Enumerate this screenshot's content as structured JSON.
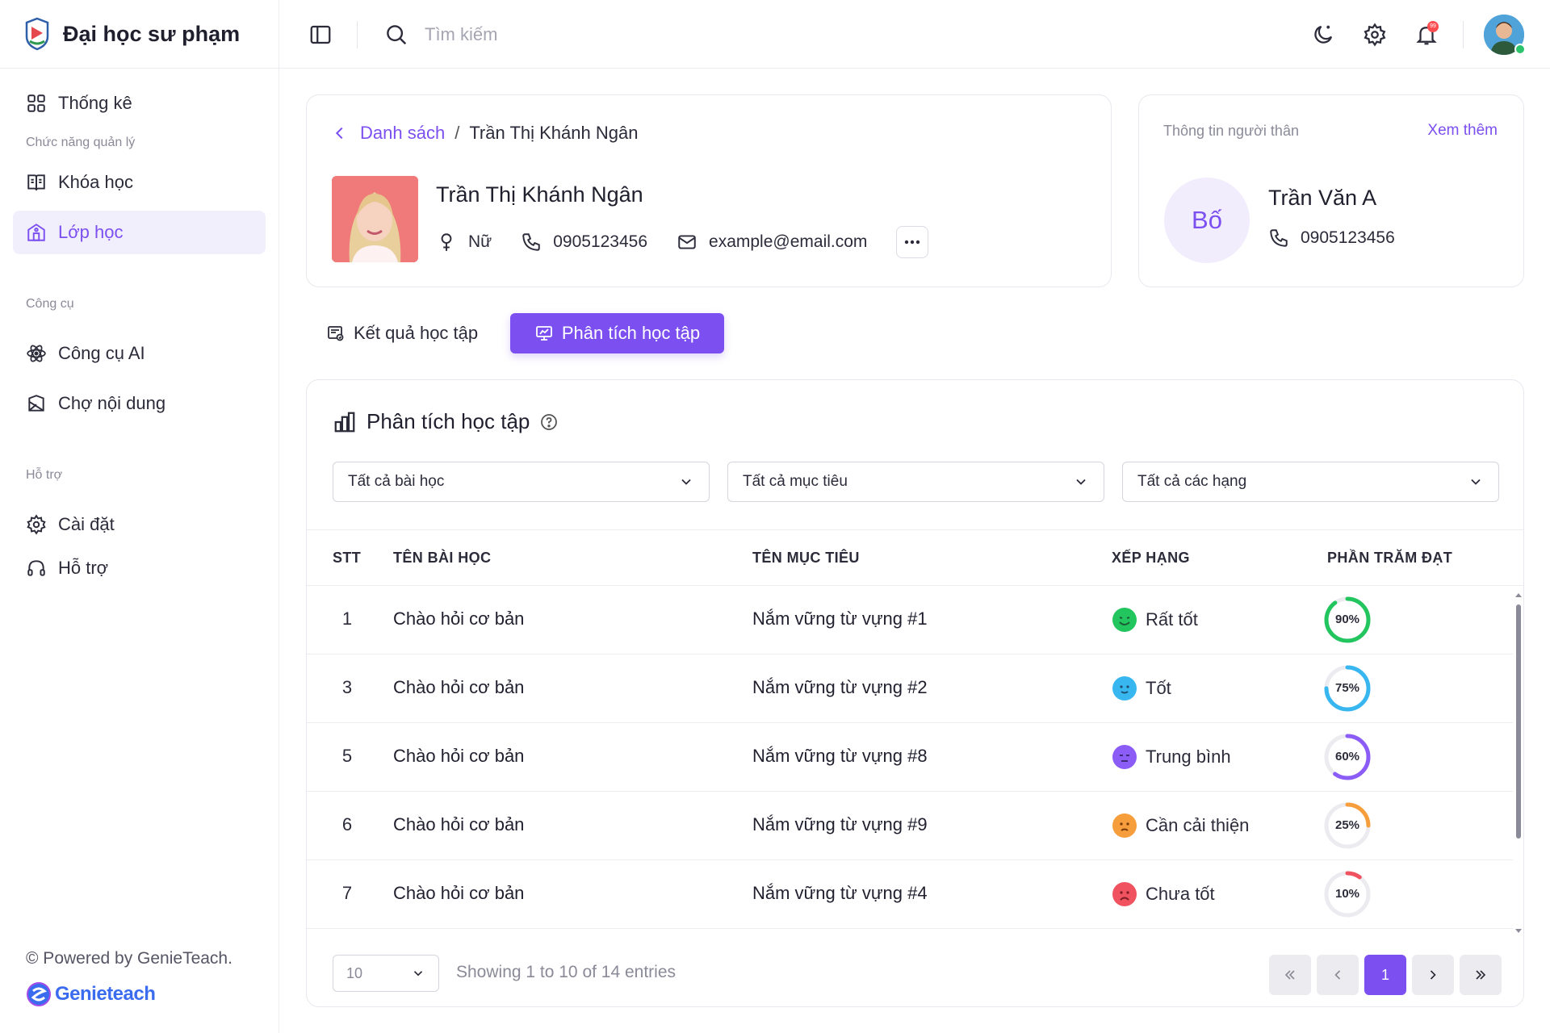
{
  "brand": {
    "name": "Đại học sư phạm"
  },
  "sidebar": {
    "items": [
      {
        "label": "Thống kê",
        "icon": "grid-icon"
      },
      {
        "label": "Khóa học",
        "icon": "book-icon"
      },
      {
        "label": "Lớp học",
        "icon": "school-icon",
        "active": true
      },
      {
        "label": "Công cụ AI",
        "icon": "atom-icon"
      },
      {
        "label": "Chợ nội dung",
        "icon": "market-icon"
      },
      {
        "label": "Cài đặt",
        "icon": "gear-icon"
      },
      {
        "label": "Hỗ trợ",
        "icon": "headset-icon"
      }
    ],
    "sections": [
      "Chức năng quản lý",
      "Công cụ",
      "Hỗ trợ"
    ],
    "powered_by": "© Powered by GenieTeach.",
    "genie_logo_text": "Genieteach"
  },
  "header": {
    "search_placeholder": "Tìm kiếm",
    "notification_count": "99"
  },
  "profile": {
    "breadcrumb_link": "Danh sách",
    "breadcrumb_sep": "/",
    "breadcrumb_current": "Trần Thị Khánh Ngân",
    "name": "Trần Thị Khánh Ngân",
    "gender": "Nữ",
    "phone": "0905123456",
    "email": "example@email.com"
  },
  "relative": {
    "title": "Thông tin người thân",
    "more": "Xem thêm",
    "relation": "Bố",
    "name": "Trần Văn A",
    "phone": "0905123456"
  },
  "tabs": {
    "results": "Kết quả học tập",
    "analysis": "Phân tích học tập"
  },
  "analysis": {
    "title": "Phân tích học tập",
    "filters": [
      "Tất cả bài học",
      "Tất cả mục tiêu",
      "Tất cả các hạng"
    ],
    "columns": [
      "STT",
      "TÊN BÀI HỌC",
      "TÊN MỤC TIÊU",
      "XẾP HẠNG",
      "PHẦN TRĂM ĐẠT"
    ],
    "rows": [
      {
        "stt": "1",
        "lesson": "Chào hỏi cơ bản",
        "goal": "Nắm vững từ vựng #1",
        "rank": "Rất tốt",
        "percent": 90,
        "percent_label": "90%",
        "color": "#22c55e"
      },
      {
        "stt": "3",
        "lesson": "Chào hỏi cơ bản",
        "goal": "Nắm vững từ vựng #2",
        "rank": "Tốt",
        "percent": 75,
        "percent_label": "75%",
        "color": "#38b6f0"
      },
      {
        "stt": "5",
        "lesson": "Chào hỏi cơ bản",
        "goal": "Nắm vững từ vựng #8",
        "rank": "Trung bình",
        "percent": 60,
        "percent_label": "60%",
        "color": "#8b5cf6"
      },
      {
        "stt": "6",
        "lesson": "Chào hỏi cơ bản",
        "goal": "Nắm vững từ vựng #9",
        "rank": "Cần cải thiện",
        "percent": 25,
        "percent_label": "25%",
        "color": "#f59e3b"
      },
      {
        "stt": "7",
        "lesson": "Chào hỏi cơ bản",
        "goal": "Nắm vững từ vựng #4",
        "rank": "Chưa tốt",
        "percent": 10,
        "percent_label": "10%",
        "color": "#f05260"
      }
    ],
    "page_size": "10",
    "showing": "Showing 1 to 10 of 14 entries",
    "current_page": "1"
  }
}
